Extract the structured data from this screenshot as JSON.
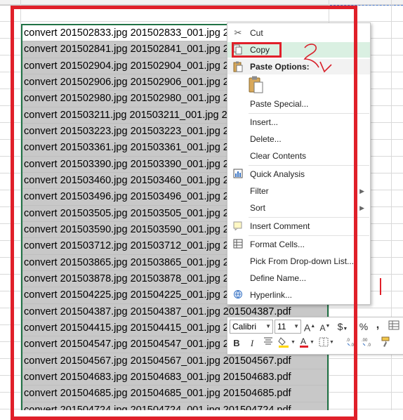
{
  "sheet": {
    "rows": [
      "convert 201502833.jpg 201502833_001.jpg 201502833.pdf",
      "convert 201502841.jpg 201502841_001.jpg 201502841.pdf",
      "convert 201502904.jpg 201502904_001.jpg 201502904.pdf",
      "convert 201502906.jpg 201502906_001.jpg 201502906.pdf",
      "convert 201502980.jpg 201502980_001.jpg 201502980.pdf",
      "convert 201503211.jpg 201503211_001.jpg 201503211.pdf",
      "convert 201503223.jpg 201503223_001.jpg 201503223.pdf",
      "convert 201503361.jpg 201503361_001.jpg 201503361.pdf",
      "convert 201503390.jpg 201503390_001.jpg 201503390.pdf",
      "convert 201503460.jpg 201503460_001.jpg 201503460.pdf",
      "convert 201503496.jpg 201503496_001.jpg 201503496.pdf",
      "convert 201503505.jpg 201503505_001.jpg 201503505.pdf",
      "convert 201503590.jpg 201503590_001.jpg 201503590.pdf",
      "convert 201503712.jpg 201503712_001.jpg 201503712.pdf",
      "convert 201503865.jpg 201503865_001.jpg 201503865.pdf",
      "convert 201503878.jpg 201503878_001.jpg 201503878.pdf",
      "convert 201504225.jpg 201504225_001.jpg 201504225.pdf",
      "convert 201504387.jpg 201504387_001.jpg 201504387.pdf",
      "convert 201504415.jpg 201504415_001.jpg 201504415.pdf",
      "convert 201504547.jpg 201504547_001.jpg 201504547.pdf",
      "convert 201504567.jpg 201504567_001.jpg 201504567.pdf",
      "convert 201504683.jpg 201504683_001.jpg 201504683.pdf",
      "convert 201504685.jpg 201504685_001.jpg 201504685.pdf",
      "convert 201504724.jpg 201504724_001.jpg 201504724.pdf"
    ]
  },
  "context_menu": {
    "cut": "Cut",
    "copy": "Copy",
    "paste_options": "Paste Options:",
    "paste_special": "Paste Special...",
    "insert": "Insert...",
    "delete": "Delete...",
    "clear_contents": "Clear Contents",
    "quick_analysis": "Quick Analysis",
    "filter": "Filter",
    "sort": "Sort",
    "insert_comment": "Insert Comment",
    "format_cells": "Format Cells...",
    "pick_from_dropdown": "Pick From Drop-down List...",
    "define_name": "Define Name...",
    "hyperlink": "Hyperlink..."
  },
  "mini_toolbar": {
    "font_name": "Calibri",
    "font_size": "11",
    "increase_font": "A",
    "decrease_font": "A",
    "currency": "$",
    "percent": "%",
    "comma": ",",
    "bold": "B",
    "italic": "I"
  },
  "colors": {
    "selection_border": "#217346",
    "annotation_red": "#e0202a",
    "copy_highlight": "#daf0e2"
  }
}
